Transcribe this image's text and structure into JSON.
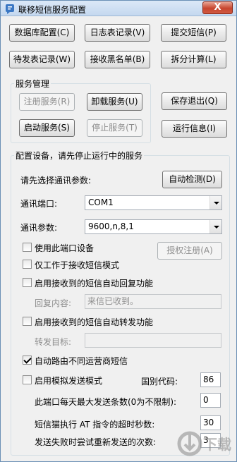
{
  "window": {
    "title": "联移短信服务配置",
    "close_glyph": "X"
  },
  "toolbar": {
    "database_config": "数据库配置(C)",
    "log_records": "日志表记录(V)",
    "submit_sms": "提交短信(P)",
    "pending_records": "待发表记录(W)",
    "blacklist": "接收黑名单(B)",
    "split_calc": "拆分计算(L)"
  },
  "service": {
    "legend": "服务管理",
    "register": "注册服务(R)",
    "uninstall": "卸载服务(U)",
    "start": "启动服务(S)",
    "stop": "停止服务(T)"
  },
  "side": {
    "save_exit": "保存退出(Q)",
    "run_info": "运行信息(I)"
  },
  "config": {
    "legend": "配置设备，请先停止运行中的服务",
    "select_params_label": "请先选择通讯参数:",
    "auto_detect": "自动检测(D)",
    "port_label": "通讯端口:",
    "port_value": "COM1",
    "params_label": "通讯参数:",
    "params_value": "9600,n,8,1",
    "use_port_device": "使用此端口设备",
    "authorize": "授权注册(A)",
    "receive_only": "仅工作于接收短信模式",
    "auto_reply": "启用接收到的短信自动回复功能",
    "reply_content_label": "回复内容:",
    "reply_content_value": "来信已收到。",
    "auto_forward": "启用接收到的短信自动转发功能",
    "forward_target_label": "转发目标:",
    "forward_target_value": "",
    "auto_route": "自动路由不同运营商短信",
    "simulate_send": "启用模拟发送模式",
    "country_code_label": "国别代码:",
    "country_code_value": "86",
    "max_daily_label": "此端口每天最大发送条数(0为不限制):",
    "max_daily_value": "0",
    "timeout_label": "短信猫执行 AT 指令的超时秒数:",
    "timeout_value": "30",
    "retry_label": "发送失败时尝试重新发送的次数:",
    "retry_value": "3"
  },
  "checkbox_states": {
    "use_port_device": false,
    "receive_only": false,
    "auto_reply": false,
    "auto_forward": false,
    "auto_route": true,
    "simulate_send": false
  },
  "watermark": {
    "text": "下载"
  }
}
